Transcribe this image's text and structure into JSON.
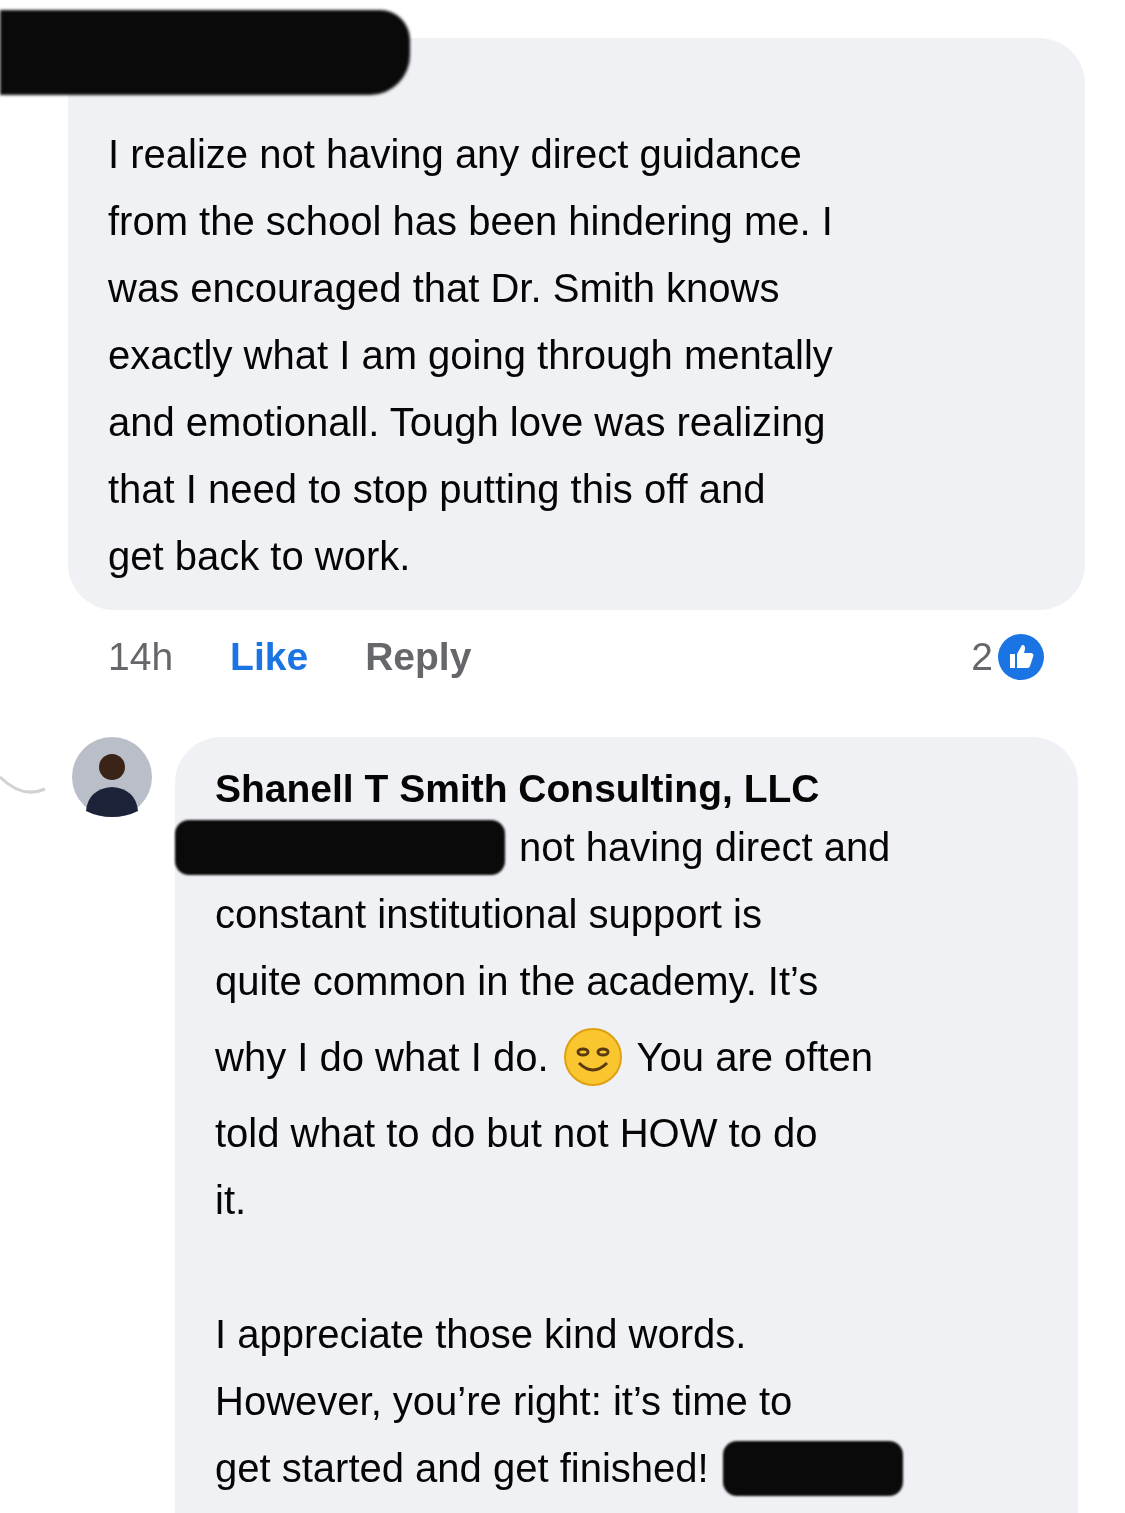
{
  "comments": [
    {
      "author_redacted": true,
      "paragraphs": [
        [
          [
            {
              "kind": "text",
              "text": "I realize not having any direct guidance"
            }
          ],
          [
            {
              "kind": "text",
              "text": "from the school has been hindering me. I"
            }
          ],
          [
            {
              "kind": "text",
              "text": "was encouraged that Dr. Smith knows"
            }
          ],
          [
            {
              "kind": "text",
              "text": "exactly what I am going through mentally"
            }
          ],
          [
            {
              "kind": "text",
              "text": "and emotionall. Tough love was realizing"
            }
          ],
          [
            {
              "kind": "text",
              "text": "that I need to stop putting this off and"
            }
          ],
          [
            {
              "kind": "text",
              "text": "get back to work."
            }
          ]
        ]
      ],
      "time": "14h",
      "like_label": "Like",
      "liked": true,
      "reply_label": "Reply",
      "reaction_count": "2"
    },
    {
      "author": "Shanell T Smith Consulting, LLC",
      "paragraphs": [
        [
          [
            {
              "kind": "redaction"
            },
            {
              "kind": "text",
              "text": "not having direct and"
            }
          ],
          [
            {
              "kind": "text",
              "text": "constant institutional support is"
            }
          ],
          [
            {
              "kind": "text",
              "text": "quite common in the academy. It’s"
            }
          ],
          [
            {
              "kind": "text",
              "text": "why I do what I do."
            },
            {
              "kind": "emoji"
            },
            {
              "kind": "text",
              "text": "You are often"
            }
          ],
          [
            {
              "kind": "text",
              "text": "told what to do but not HOW to do"
            }
          ],
          [
            {
              "kind": "text",
              "text": "it."
            }
          ]
        ],
        [
          [
            {
              "kind": "text",
              "text": "I appreciate those kind words."
            }
          ],
          [
            {
              "kind": "text",
              "text": "However, you’re right: it’s time to"
            }
          ],
          [
            {
              "kind": "text",
              "text": "get started and get finished!"
            },
            {
              "kind": "redaction"
            }
          ]
        ]
      ]
    }
  ]
}
